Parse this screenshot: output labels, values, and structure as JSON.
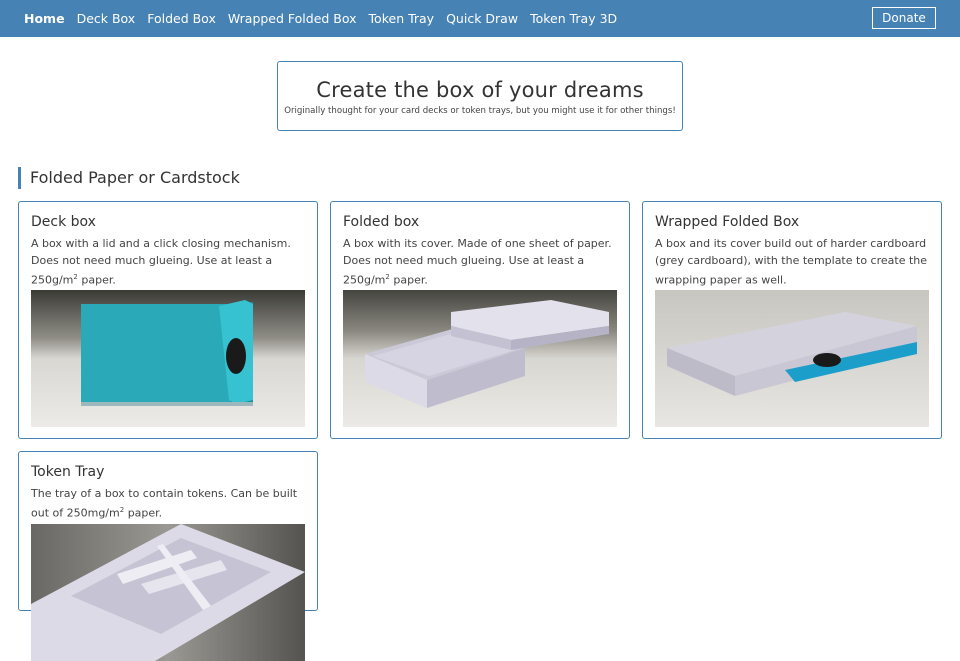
{
  "nav": {
    "items": [
      {
        "label": "Home",
        "active": true
      },
      {
        "label": "Deck Box",
        "active": false
      },
      {
        "label": "Folded Box",
        "active": false
      },
      {
        "label": "Wrapped Folded Box",
        "active": false
      },
      {
        "label": "Token Tray",
        "active": false
      },
      {
        "label": "Quick Draw",
        "active": false
      },
      {
        "label": "Token Tray 3D",
        "active": false
      }
    ],
    "donate_label": "Donate"
  },
  "hero": {
    "title": "Create the box of your dreams",
    "subtitle": "Originally thought for your card decks or token trays, but you might use it for other things!"
  },
  "section": {
    "title": "Folded Paper or Cardstock"
  },
  "cards": [
    {
      "title": "Deck box",
      "desc_pre": "A box with a lid and a click closing mechanism. Does not need much glueing. Use at least a 250g/m",
      "desc_sup": "2",
      "desc_post": " paper."
    },
    {
      "title": "Folded box",
      "desc_pre": "A box with its cover. Made of one sheet of paper. Does not need much glueing. Use at least a 250g/m",
      "desc_sup": "2",
      "desc_post": " paper."
    },
    {
      "title": "Wrapped Folded Box",
      "desc_pre": "A box and its cover build out of harder cardboard (grey cardboard), with the template to create the wrapping paper as well.",
      "desc_sup": "",
      "desc_post": ""
    },
    {
      "title": "Token Tray",
      "desc_pre": "The tray of a box to contain tokens. Can be built out of 250mg/m",
      "desc_sup": "2",
      "desc_post": " paper."
    }
  ],
  "colors": {
    "primary": "#4682b4",
    "teal_box": "#2fb5c4",
    "text": "#333333"
  }
}
